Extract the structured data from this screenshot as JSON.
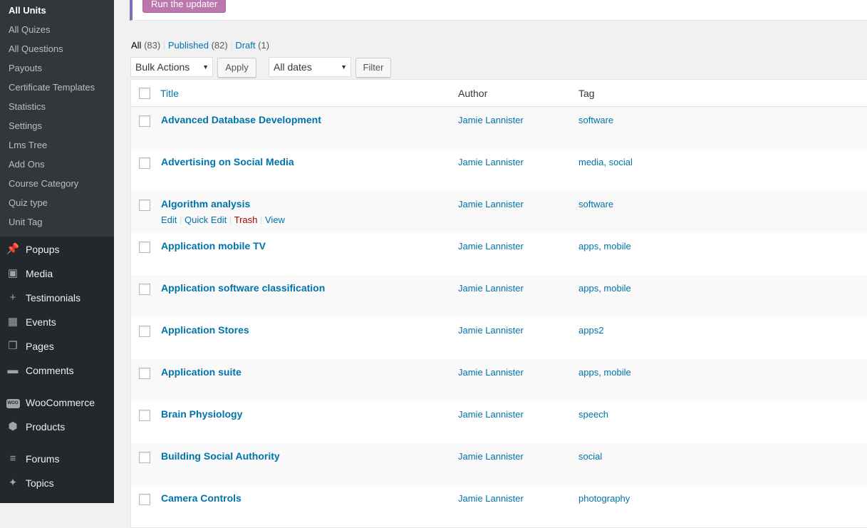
{
  "sidebar": {
    "submenu": [
      {
        "label": "All Units",
        "current": true
      },
      {
        "label": "All Quizes"
      },
      {
        "label": "All Questions"
      },
      {
        "label": "Payouts"
      },
      {
        "label": "Certificate Templates"
      },
      {
        "label": "Statistics"
      },
      {
        "label": "Settings"
      },
      {
        "label": "Lms Tree"
      },
      {
        "label": "Add Ons"
      },
      {
        "label": "Course Category"
      },
      {
        "label": "Quiz type"
      },
      {
        "label": "Unit Tag"
      }
    ],
    "menu": [
      {
        "label": "Popups",
        "icon": "pin-icon"
      },
      {
        "label": "Media",
        "icon": "media-icon"
      },
      {
        "label": "Testimonials",
        "icon": "plus-icon"
      },
      {
        "label": "Events",
        "icon": "calendar-icon"
      },
      {
        "label": "Pages",
        "icon": "pages-icon"
      },
      {
        "label": "Comments",
        "icon": "comment-icon"
      },
      {
        "label": "WooCommerce",
        "icon": "woo-icon",
        "badge": "WOO"
      },
      {
        "label": "Products",
        "icon": "box-icon"
      },
      {
        "label": "Forums",
        "icon": "forums-icon"
      },
      {
        "label": "Topics",
        "icon": "topics-icon"
      }
    ]
  },
  "notice": {
    "button_label": "Run the updater",
    "accent": "#826eb4",
    "button_color": "#bb77ae"
  },
  "views": {
    "all": {
      "label": "All",
      "count": "(83)"
    },
    "published": {
      "label": "Published",
      "count": "(82)"
    },
    "draft": {
      "label": "Draft",
      "count": "(1)"
    },
    "separator": "|"
  },
  "filters": {
    "bulk_actions": "Bulk Actions",
    "apply": "Apply",
    "dates": "All dates",
    "filter": "Filter"
  },
  "table": {
    "headers": {
      "title": "Title",
      "author": "Author",
      "tag": "Tag"
    },
    "row_actions": {
      "edit": "Edit",
      "quick_edit": "Quick Edit",
      "trash": "Trash",
      "view": "View"
    },
    "rows": [
      {
        "title": "Advanced Database Development",
        "author": "Jamie Lannister",
        "tags": "software"
      },
      {
        "title": "Advertising on Social Media",
        "author": "Jamie Lannister",
        "tags": "media, social"
      },
      {
        "title": "Algorithm analysis",
        "author": "Jamie Lannister",
        "tags": "software",
        "hovered": true
      },
      {
        "title": "Application mobile TV",
        "author": "Jamie Lannister",
        "tags": "apps, mobile"
      },
      {
        "title": "Application software classification",
        "author": "Jamie Lannister",
        "tags": "apps, mobile"
      },
      {
        "title": "Application Stores",
        "author": "Jamie Lannister",
        "tags": "apps2"
      },
      {
        "title": "Application suite",
        "author": "Jamie Lannister",
        "tags": "apps, mobile"
      },
      {
        "title": "Brain Physiology",
        "author": "Jamie Lannister",
        "tags": "speech"
      },
      {
        "title": "Building Social Authority",
        "author": "Jamie Lannister",
        "tags": "social"
      },
      {
        "title": "Camera Controls",
        "author": "Jamie Lannister",
        "tags": "photography"
      }
    ]
  },
  "colors": {
    "link": "#0073aa",
    "sidebar_bg": "#23282d",
    "submenu_bg": "#32373c",
    "trash": "#a00"
  }
}
